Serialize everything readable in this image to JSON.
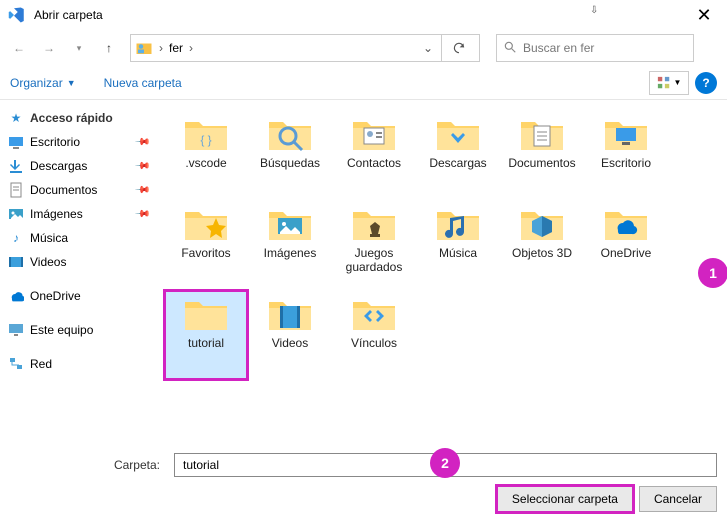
{
  "window": {
    "title": "Abrir carpeta"
  },
  "nav": {
    "breadcrumb": [
      "fer"
    ],
    "search_placeholder": "Buscar en fer"
  },
  "toolbar": {
    "organize": "Organizar",
    "new_folder": "Nueva carpeta"
  },
  "sidebar": {
    "quick_access": "Acceso rápido",
    "quick_items": [
      {
        "label": "Escritorio",
        "pinned": true
      },
      {
        "label": "Descargas",
        "pinned": true
      },
      {
        "label": "Documentos",
        "pinned": true
      },
      {
        "label": "Imágenes",
        "pinned": true
      },
      {
        "label": "Música",
        "pinned": false
      },
      {
        "label": "Videos",
        "pinned": false
      }
    ],
    "onedrive": "OneDrive",
    "this_pc": "Este equipo",
    "network": "Red"
  },
  "folders": [
    {
      "name": ".vscode",
      "icon": "braces"
    },
    {
      "name": "Búsquedas",
      "icon": "search"
    },
    {
      "name": "Contactos",
      "icon": "contact"
    },
    {
      "name": "Descargas",
      "icon": "download"
    },
    {
      "name": "Documentos",
      "icon": "document"
    },
    {
      "name": "Escritorio",
      "icon": "desktop"
    },
    {
      "name": "Favoritos",
      "icon": "star"
    },
    {
      "name": "Imágenes",
      "icon": "image"
    },
    {
      "name": "Juegos guardados",
      "icon": "chess"
    },
    {
      "name": "Música",
      "icon": "music"
    },
    {
      "name": "Objetos 3D",
      "icon": "cube"
    },
    {
      "name": "OneDrive",
      "icon": "cloud"
    },
    {
      "name": "tutorial",
      "icon": "plain",
      "selected": true
    },
    {
      "name": "Videos",
      "icon": "film"
    },
    {
      "name": "Vínculos",
      "icon": "link"
    }
  ],
  "footer": {
    "label": "Carpeta:",
    "value": "tutorial",
    "select": "Seleccionar carpeta",
    "cancel": "Cancelar"
  },
  "callouts": {
    "one": "1",
    "two": "2"
  }
}
